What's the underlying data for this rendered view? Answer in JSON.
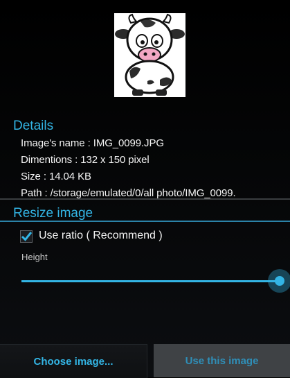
{
  "preview": {
    "image_name": "cow-icon"
  },
  "details": {
    "title": "Details",
    "name_line": "Image's name : IMG_0099.JPG",
    "dimensions_line": "Dimentions : 132 x 150 pixel",
    "size_line": "Size : 14.04 KB",
    "path_line": "Path : /storage/emulated/0/all photo/IMG_0099."
  },
  "resize": {
    "title": "Resize image",
    "ratio_label": "Use ratio ( Recommend )",
    "ratio_checked": true,
    "height_label": "Height",
    "height_slider_value": 1.0
  },
  "buttons": {
    "choose": "Choose image...",
    "use": "Use this image"
  },
  "colors": {
    "accent": "#33b5e5",
    "background": "#000000",
    "disabled_button": "#3f4245"
  }
}
